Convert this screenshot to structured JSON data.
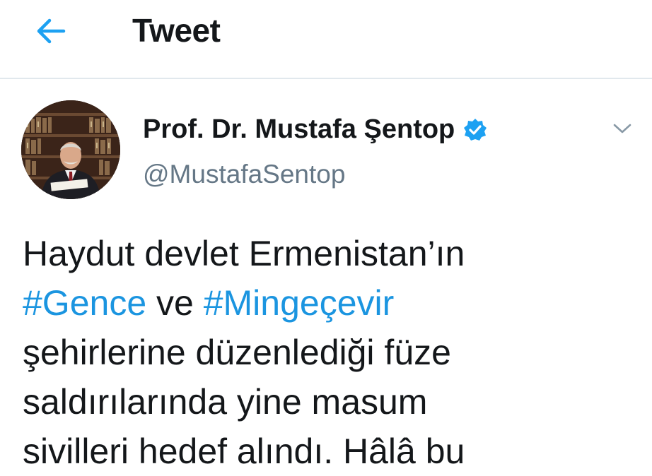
{
  "header": {
    "back_icon": "arrow-left-icon",
    "title": "Tweet"
  },
  "author": {
    "avatar_icon": "profile-photo",
    "name": "Prof. Dr. Mustafa Şentop",
    "verified_icon": "verified-badge-icon",
    "handle": "@MustafaSentop",
    "more_icon": "chevron-down-icon"
  },
  "tweet": {
    "line1": "Haydut devlet Ermenistan’ın",
    "hashtag_gence": "#Gence",
    "ve": " ve ",
    "hashtag_mingecevir": "#Mingeçevir",
    "line3": "şehirlerine düzenlediği füze",
    "line4": "saldırılarında yine masum",
    "line5": "sivilleri hedef alındı. Hâlâ bu"
  },
  "colors": {
    "accent": "#1b95e0",
    "verified": "#1da1f2",
    "text": "#14171a",
    "secondary": "#657786",
    "divider": "#e1e8ed"
  }
}
